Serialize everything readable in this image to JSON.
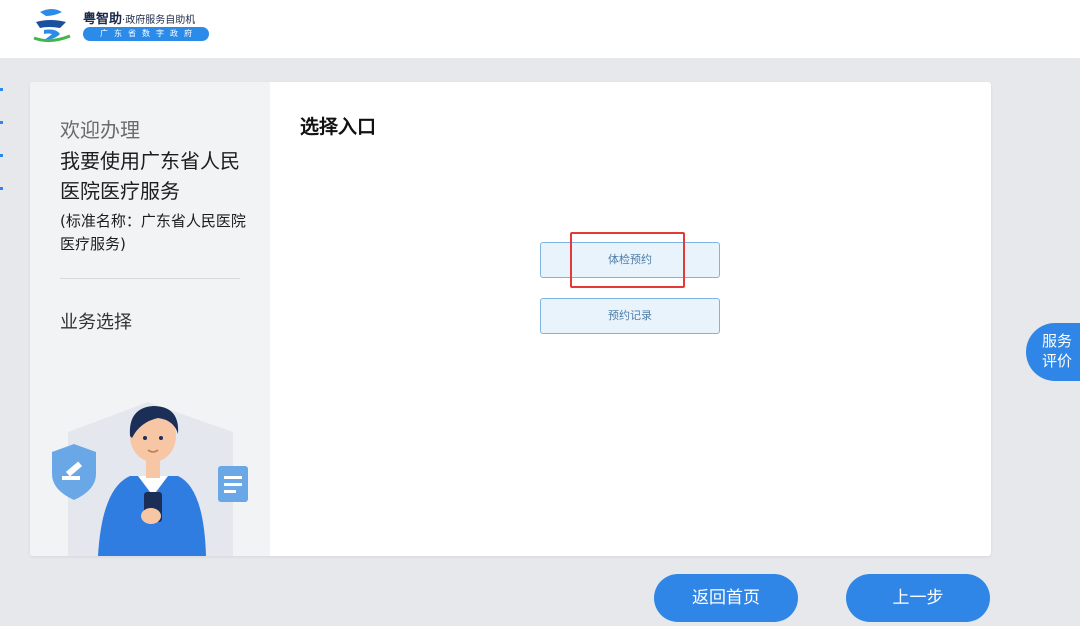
{
  "header": {
    "logo_title": "粤智助",
    "logo_subtitle": "·政府服务自助机",
    "logo_pill": "广东省数字政府"
  },
  "left_panel": {
    "welcome": "欢迎办理",
    "service_name": "我要使用广东省人民医院医疗服务",
    "standard_name": "(标准名称：广东省人民医院医疗服务)",
    "business_choice": "业务选择"
  },
  "main": {
    "title": "选择入口",
    "entries": [
      {
        "label": "体检预约",
        "highlighted": true
      },
      {
        "label": "预约记录",
        "highlighted": false
      }
    ],
    "highlight_color": "#e53935"
  },
  "feedback_tab": {
    "line1": "服务",
    "line2": "评价"
  },
  "footer": {
    "home_label": "返回首页",
    "prev_label": "上一步"
  },
  "colors": {
    "accent": "#2f86e6",
    "entry_bg": "#e9f3fc",
    "entry_border": "#7fb3e0"
  }
}
